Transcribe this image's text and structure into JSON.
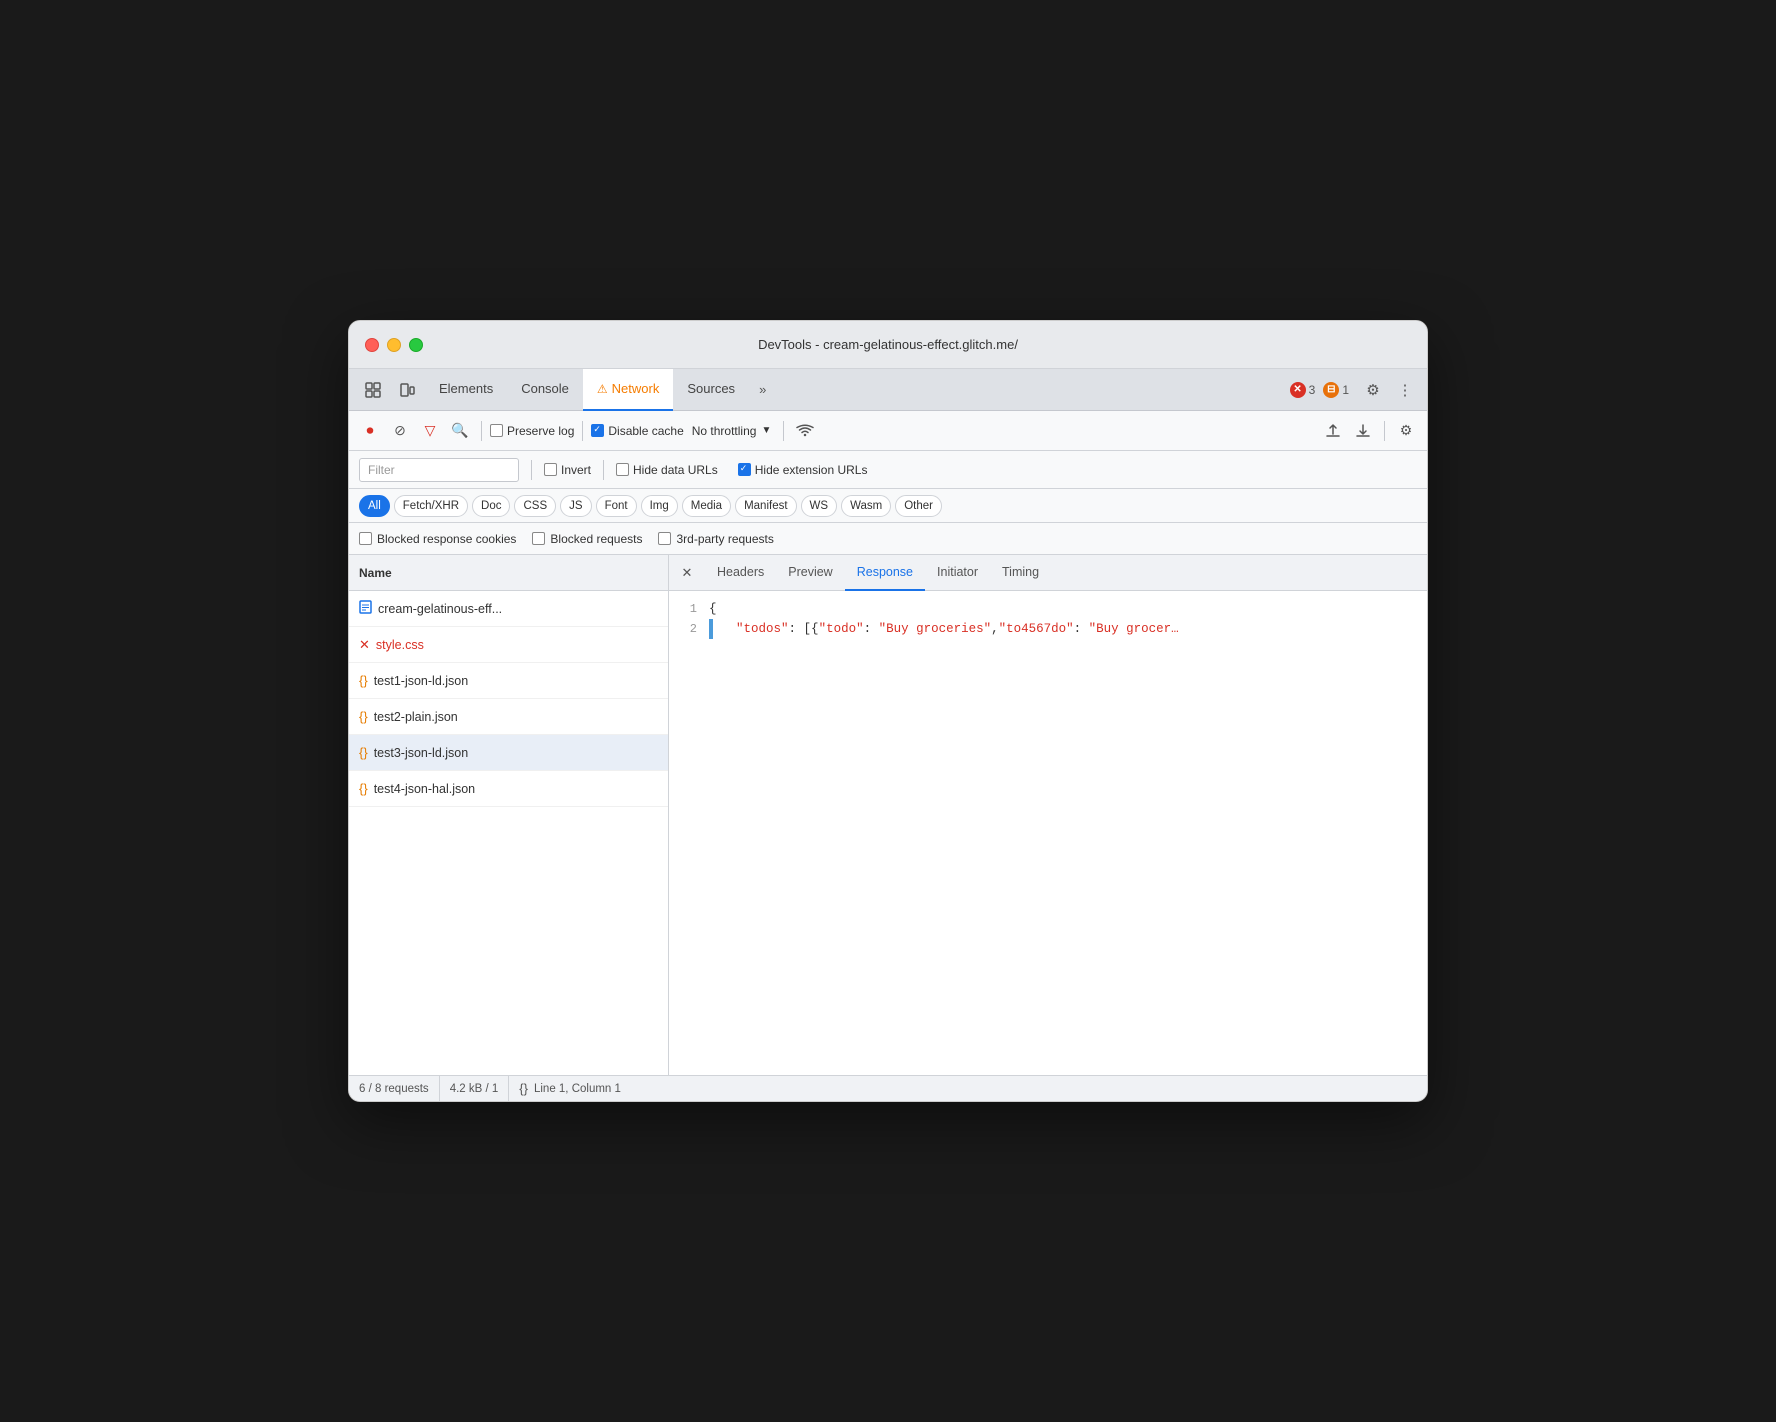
{
  "window": {
    "title": "DevTools - cream-gelatinous-effect.glitch.me/"
  },
  "tabs": [
    {
      "id": "elements",
      "label": "Elements",
      "active": false
    },
    {
      "id": "console",
      "label": "Console",
      "active": false
    },
    {
      "id": "network",
      "label": "Network",
      "active": true,
      "has_warning": true
    },
    {
      "id": "sources",
      "label": "Sources",
      "active": false
    }
  ],
  "tab_more_label": "»",
  "error_badges": [
    {
      "type": "error",
      "count": "3",
      "color": "red"
    },
    {
      "type": "warning",
      "count": "1",
      "color": "orange"
    }
  ],
  "toolbar": {
    "preserve_log_label": "Preserve log",
    "disable_cache_label": "Disable cache",
    "throttle_label": "No throttling"
  },
  "filter": {
    "placeholder": "Filter",
    "invert_label": "Invert",
    "hide_data_urls_label": "Hide data URLs",
    "hide_extension_urls_label": "Hide extension URLs"
  },
  "type_filters": [
    {
      "id": "all",
      "label": "All",
      "active": true
    },
    {
      "id": "fetch_xhr",
      "label": "Fetch/XHR",
      "active": false
    },
    {
      "id": "doc",
      "label": "Doc",
      "active": false
    },
    {
      "id": "css",
      "label": "CSS",
      "active": false
    },
    {
      "id": "js",
      "label": "JS",
      "active": false
    },
    {
      "id": "font",
      "label": "Font",
      "active": false
    },
    {
      "id": "img",
      "label": "Img",
      "active": false
    },
    {
      "id": "media",
      "label": "Media",
      "active": false
    },
    {
      "id": "manifest",
      "label": "Manifest",
      "active": false
    },
    {
      "id": "ws",
      "label": "WS",
      "active": false
    },
    {
      "id": "wasm",
      "label": "Wasm",
      "active": false
    },
    {
      "id": "other",
      "label": "Other",
      "active": false
    }
  ],
  "checkbox_filters": [
    {
      "id": "blocked_cookies",
      "label": "Blocked response cookies",
      "checked": false
    },
    {
      "id": "blocked_requests",
      "label": "Blocked requests",
      "checked": false
    },
    {
      "id": "third_party",
      "label": "3rd-party requests",
      "checked": false
    }
  ],
  "file_list": {
    "header": "Name",
    "files": [
      {
        "id": "main",
        "name": "cream-gelatinous-eff...",
        "type": "doc",
        "error": false,
        "selected": false
      },
      {
        "id": "style",
        "name": "style.css",
        "type": "css",
        "error": true,
        "selected": false
      },
      {
        "id": "test1",
        "name": "test1-json-ld.json",
        "type": "json",
        "error": false,
        "selected": false
      },
      {
        "id": "test2",
        "name": "test2-plain.json",
        "type": "json",
        "error": false,
        "selected": false
      },
      {
        "id": "test3",
        "name": "test3-json-ld.json",
        "type": "json",
        "error": false,
        "selected": true
      },
      {
        "id": "test4",
        "name": "test4-json-hal.json",
        "type": "json",
        "error": false,
        "selected": false
      }
    ]
  },
  "response_panel": {
    "tabs": [
      {
        "id": "headers",
        "label": "Headers",
        "active": false
      },
      {
        "id": "preview",
        "label": "Preview",
        "active": false
      },
      {
        "id": "response",
        "label": "Response",
        "active": true
      },
      {
        "id": "initiator",
        "label": "Initiator",
        "active": false
      },
      {
        "id": "timing",
        "label": "Timing",
        "active": false
      }
    ],
    "code_lines": [
      {
        "number": "1",
        "has_gutter": false,
        "content": "{"
      },
      {
        "number": "2",
        "has_gutter": true,
        "content": "  \"todos\": [{\"todo\": \"Buy groceries\",\"to4567do\": \"Buy grocer…"
      }
    ]
  },
  "status_bar": {
    "requests": "6 / 8 requests",
    "size": "4.2 kB / 1",
    "format_icon": "{}",
    "position": "Line 1, Column 1"
  }
}
